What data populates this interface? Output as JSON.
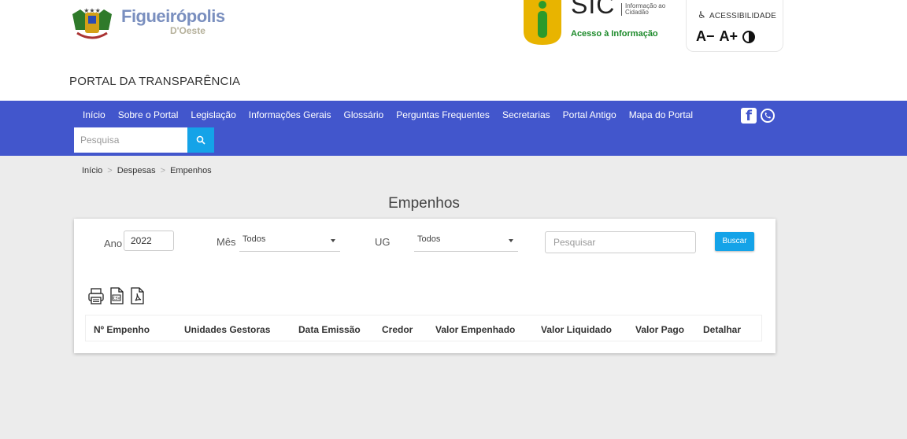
{
  "header": {
    "logo_name": "Figueirópolis",
    "logo_sub": "D'Oeste",
    "portal_title": "PORTAL DA TRANSPARÊNCIA",
    "sic_big": "SIC",
    "sic_small": "Informação ao Cidadão",
    "sic_acesso": "Acesso à Informação",
    "accessibility_label": "ACESSIBILIDADE",
    "font_decrease": "A−",
    "font_increase": "A+"
  },
  "nav": {
    "items": [
      "Início",
      "Sobre o Portal",
      "Legislação",
      "Informações Gerais",
      "Glossário",
      "Perguntas Frequentes",
      "Secretarias",
      "Portal Antigo",
      "Mapa do Portal"
    ],
    "search_placeholder": "Pesquisa",
    "facebook_glyph": "f"
  },
  "breadcrumb": [
    "Início",
    "Despesas",
    "Empenhos"
  ],
  "page_title": "Empenhos",
  "filters": {
    "ano_label": "Ano",
    "ano_value": "2022",
    "mes_label": "Mês",
    "mes_value": "Todos",
    "ug_label": "UG",
    "ug_value": "Todos",
    "search_placeholder": "Pesquisar",
    "buscar_label": "Buscar"
  },
  "table": {
    "columns": [
      "Nº Empenho",
      "Unidades Gestoras",
      "Data Emissão",
      "Credor",
      "Valor Empenhado",
      "Valor Liquidado",
      "Valor Pago",
      "Detalhar"
    ]
  },
  "colors": {
    "navbar": "#4256cc",
    "accent": "#14a3e8",
    "background": "#ececec"
  }
}
